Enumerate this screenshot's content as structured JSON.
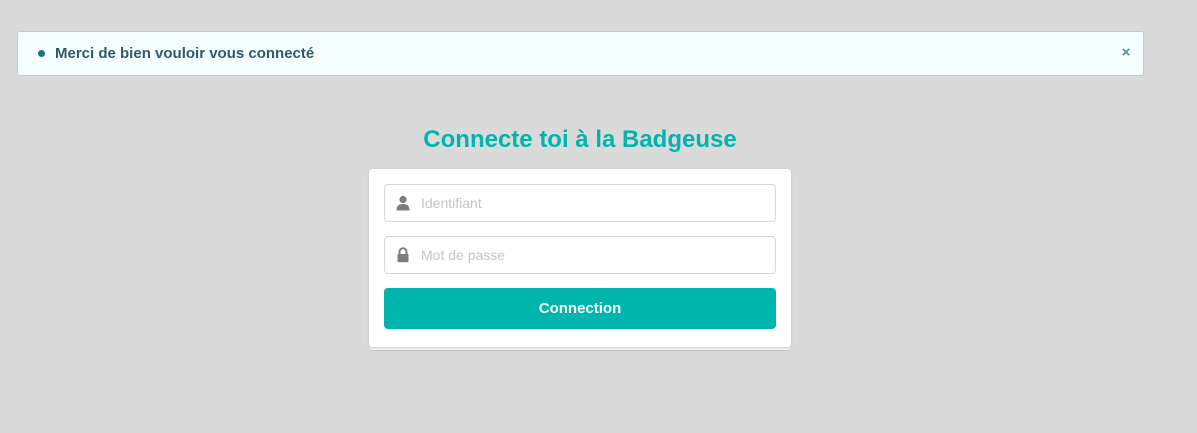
{
  "alert": {
    "message": "Merci de bien vouloir vous connecté",
    "close_icon": "×"
  },
  "login": {
    "title": "Connecte toi à la Badgeuse",
    "username_placeholder": "Identifiant",
    "password_placeholder": "Mot de passe",
    "submit_label": "Connection"
  },
  "colors": {
    "background": "#dadada",
    "accent": "#00b5ad",
    "alert_background": "#f5fefe",
    "alert_text": "#32596b"
  },
  "icons": {
    "username": "user-icon",
    "password": "lock-icon",
    "close": "close-icon"
  }
}
